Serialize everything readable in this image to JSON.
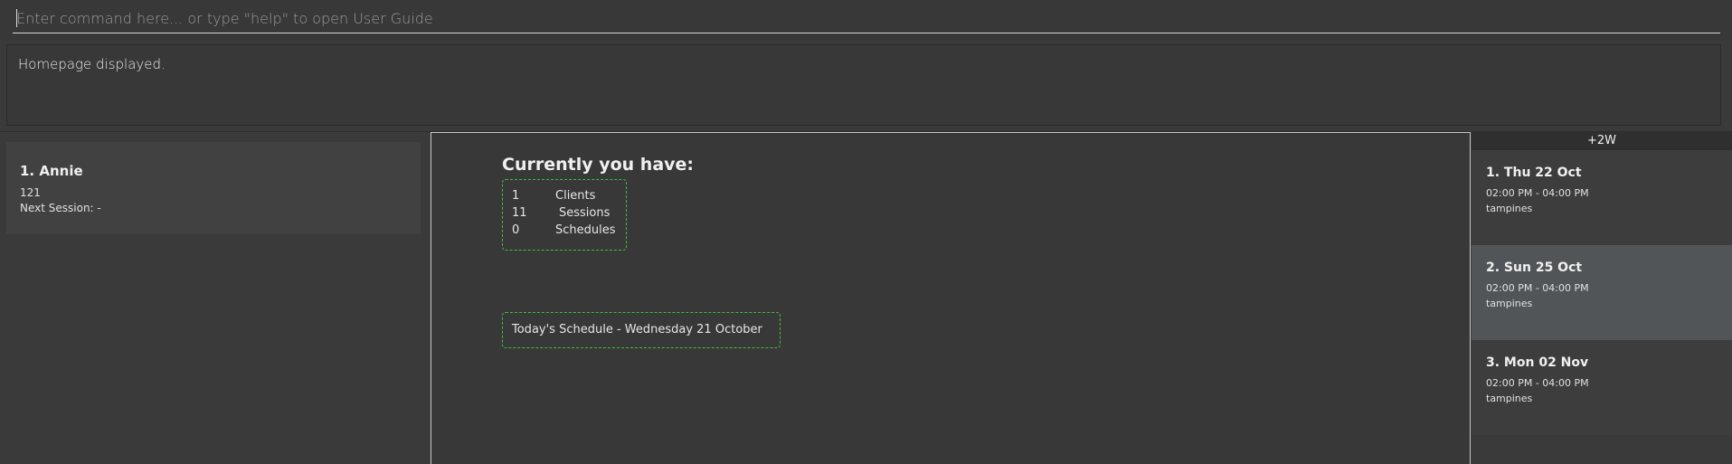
{
  "command": {
    "placeholder": "Enter command here... or type \"help\" to open User Guide",
    "value": ""
  },
  "result": {
    "message": "Homepage displayed."
  },
  "clients": [
    {
      "name": "1.  Annie",
      "id": "121",
      "next_session": "Next Session:  -"
    }
  ],
  "summary": {
    "title": "Currently you have:",
    "stats": [
      {
        "count": "1",
        "label": "Clients"
      },
      {
        "count": "11",
        "label": "Sessions"
      },
      {
        "count": "0",
        "label": "Schedules"
      }
    ],
    "today": "Today's Schedule - Wednesday 21 October"
  },
  "sessions": {
    "header": "+2W",
    "items": [
      {
        "date": "1.  Thu 22 Oct",
        "time": "02:00 PM - 04:00 PM",
        "location": "tampines"
      },
      {
        "date": "2.  Sun 25 Oct",
        "time": "02:00 PM - 04:00 PM",
        "location": "tampines"
      },
      {
        "date": "3.  Mon 02 Nov",
        "time": "02:00 PM - 04:00 PM",
        "location": "tampines"
      }
    ]
  },
  "colors": {
    "background": "#3a3a3a",
    "accent_border": "#3fbf3f",
    "selected_card": "#525557"
  }
}
